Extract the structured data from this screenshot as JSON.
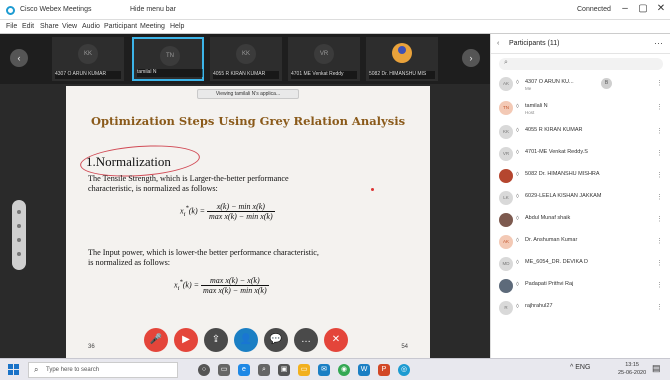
{
  "titlebar": {
    "app_title": "Cisco Webex Meetings",
    "share_label": "Hide menu bar",
    "connection": "Connected",
    "minimize": "–",
    "maximize": "▢",
    "close": "✕"
  },
  "menubar": [
    "File",
    "Edit",
    "Share",
    "View",
    "Audio",
    "Participant",
    "Meeting",
    "Help"
  ],
  "video_tiles": [
    {
      "initials": "KK",
      "label": "4307 O ARUN KUMAR",
      "active": false
    },
    {
      "initials": "TN",
      "label": "tamilal N",
      "active": true
    },
    {
      "initials": "KK",
      "label": "4055 R KIRAN KUMAR",
      "active": false
    },
    {
      "initials": "VR",
      "label": "4701 ME Venkat Reddy",
      "active": false
    },
    {
      "initials": "",
      "label": "5082 Dr. HIMANSHU MIS",
      "active": false
    }
  ],
  "strip_prev": "‹",
  "strip_next": "›",
  "viewing_banner": "Viewing tamilali N's applica...",
  "slide": {
    "title": "Optimization Steps Using Grey Relation Analysis",
    "heading": "1.Normalization",
    "para1_line1": "The Tensile Strength, which is Larger-the-better performance",
    "para1_line2": "characteristic, is normalized as follows:",
    "formula1_lhs": "x",
    "formula1_num": "x(k) − min x(k)",
    "formula1_den": "max x(k) − min x(k)",
    "para2_line1": "The Input power, which is lower-the better performance characteristic,",
    "para2_line2": "is normalized as follows:",
    "formula2_lhs": "x",
    "formula2_num": "max x(k) − x(k)",
    "formula2_den": "max x(k) − min x(k)",
    "page_left": "36",
    "page_right": "54"
  },
  "controls": [
    {
      "name": "mute",
      "icon": "🎤",
      "color": "#e4453a"
    },
    {
      "name": "video",
      "icon": "▶",
      "color": "#e4453a"
    },
    {
      "name": "share",
      "icon": "⇪",
      "color": "#4a4a4a"
    },
    {
      "name": "participants",
      "icon": "👤",
      "color": "#1b7fc4"
    },
    {
      "name": "chat",
      "icon": "💬",
      "color": "#4a4a4a"
    },
    {
      "name": "more",
      "icon": "…",
      "color": "#4a4a4a"
    },
    {
      "name": "leave",
      "icon": "✕",
      "color": "#e4453a"
    }
  ],
  "panel": {
    "title": "Participants (11)",
    "search_icon": "⌕",
    "participants": [
      {
        "initials": "AK",
        "name": "4307 O ARUN KU...",
        "sub": "Me",
        "type": "gray",
        "badge": "B"
      },
      {
        "initials": "TN",
        "name": "tamilali N",
        "sub": "Host",
        "type": "orange"
      },
      {
        "initials": "KK",
        "name": "4055 R KIRAN KUMAR",
        "sub": "",
        "type": "gray"
      },
      {
        "initials": "VR",
        "name": "4701-ME Venkat Reddy.S",
        "sub": "",
        "type": "gray"
      },
      {
        "initials": "",
        "name": "5082 Dr. HIMANSHU MISHRA",
        "sub": "",
        "type": "photo3"
      },
      {
        "initials": "LK",
        "name": "6029-LEELA KISHAN JAKKAM",
        "sub": "",
        "type": "gray"
      },
      {
        "initials": "",
        "name": "Abdul Munaf shaik",
        "sub": "",
        "type": "photo"
      },
      {
        "initials": "AK",
        "name": "Dr. Anshuman Kumar",
        "sub": "",
        "type": "orange"
      },
      {
        "initials": "MD",
        "name": "ME_6054_DR. DEVIKA D",
        "sub": "",
        "type": "gray"
      },
      {
        "initials": "",
        "name": "Padapati Prithvi Raj",
        "sub": "",
        "type": "photo2"
      },
      {
        "initials": "R",
        "name": "rajhrahul27",
        "sub": "",
        "type": "gray"
      }
    ]
  },
  "taskbar": {
    "search_placeholder": "Type here to search",
    "clock_time": "13:15",
    "clock_date": "25-06-2020",
    "tray_text": "^ ENG"
  }
}
